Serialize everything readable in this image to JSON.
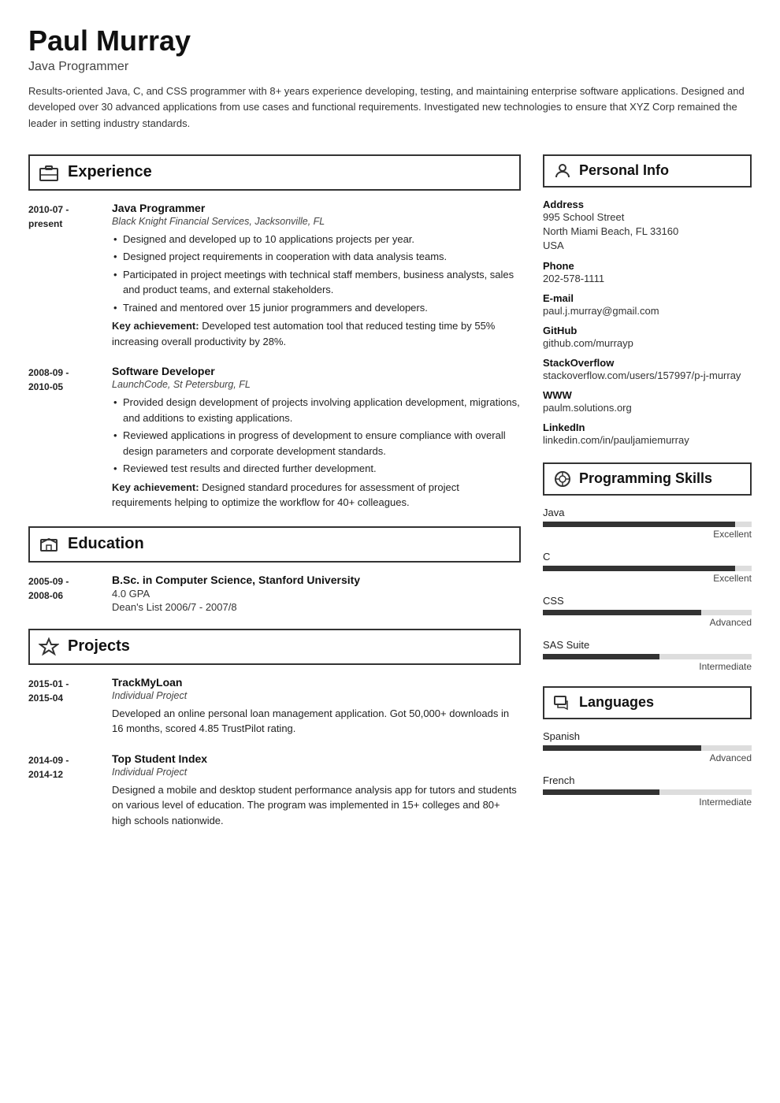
{
  "header": {
    "name": "Paul Murray",
    "title": "Java Programmer",
    "summary": "Results-oriented Java, C, and CSS programmer with 8+ years experience developing, testing, and maintaining enterprise software applications. Designed and developed over 30 advanced applications from use cases and functional requirements. Investigated new technologies to ensure that XYZ Corp remained the leader in setting industry standards."
  },
  "experience": {
    "section_label": "Experience",
    "entries": [
      {
        "date": "2010-07 -\npresent",
        "title": "Java Programmer",
        "company": "Black Knight Financial Services, Jacksonville, FL",
        "bullets": [
          "Designed and developed up to 10 applications projects per year.",
          "Designed project requirements in cooperation with data analysis teams.",
          "Participated in project meetings with technical staff members, business analysts, sales and product teams, and external stakeholders.",
          "Trained and mentored over 15 junior programmers and developers."
        ],
        "achievement": "Key achievement: Developed test automation tool that reduced testing time by 55% increasing overall productivity by 28%."
      },
      {
        "date": "2008-09 -\n2010-05",
        "title": "Software Developer",
        "company": "LaunchCode, St Petersburg, FL",
        "bullets": [
          "Provided design development of projects involving application development, migrations, and additions to existing applications.",
          "Reviewed applications in progress of development to ensure compliance with overall design parameters and corporate development standards.",
          "Reviewed test results and directed further development."
        ],
        "achievement": "Key achievement: Designed standard procedures for assessment of project requirements helping to optimize the workflow for 40+ colleagues."
      }
    ]
  },
  "education": {
    "section_label": "Education",
    "entries": [
      {
        "date": "2005-09 -\n2008-06",
        "title": "B.Sc. in Computer Science, Stanford University",
        "company": "",
        "gpa": "4.0 GPA",
        "deans": "Dean's List 2006/7 - 2007/8"
      }
    ]
  },
  "projects": {
    "section_label": "Projects",
    "entries": [
      {
        "date": "2015-01 -\n2015-04",
        "title": "TrackMyLoan",
        "type": "Individual Project",
        "desc": "Developed an online personal loan management application. Got 50,000+ downloads in 16 months, scored 4.85 TrustPilot rating."
      },
      {
        "date": "2014-09 -\n2014-12",
        "title": "Top Student Index",
        "type": "Individual Project",
        "desc": "Designed a mobile and desktop student performance analysis app for tutors and students on various level of education. The program was implemented in 15+ colleges and 80+ high schools nationwide."
      }
    ]
  },
  "personal_info": {
    "section_label": "Personal Info",
    "fields": [
      {
        "label": "Address",
        "value": "995 School Street\nNorth Miami Beach, FL 33160\nUSA"
      },
      {
        "label": "Phone",
        "value": "202-578-1111"
      },
      {
        "label": "E-mail",
        "value": "paul.j.murray@gmail.com"
      },
      {
        "label": "GitHub",
        "value": "github.com/murrayp"
      },
      {
        "label": "StackOverflow",
        "value": "stackoverflow.com/users/157997/p-j-murray"
      },
      {
        "label": "WWW",
        "value": "paulm.solutions.org"
      },
      {
        "label": "LinkedIn",
        "value": "linkedin.com/in/pauljamiemurray"
      }
    ]
  },
  "programming_skills": {
    "section_label": "Programming Skills",
    "skills": [
      {
        "name": "Java",
        "level": "Excellent",
        "pct": 92
      },
      {
        "name": "C",
        "level": "Excellent",
        "pct": 92
      },
      {
        "name": "CSS",
        "level": "Advanced",
        "pct": 76
      },
      {
        "name": "SAS Suite",
        "level": "Intermediate",
        "pct": 56
      }
    ]
  },
  "languages": {
    "section_label": "Languages",
    "items": [
      {
        "name": "Spanish",
        "level": "Advanced",
        "pct": 76
      },
      {
        "name": "French",
        "level": "Intermediate",
        "pct": 56
      }
    ]
  },
  "icons": {
    "experience": "💼",
    "education": "🎓",
    "projects": "⭐",
    "personal": "👤",
    "programming": "⚙️",
    "languages": "🚩"
  }
}
